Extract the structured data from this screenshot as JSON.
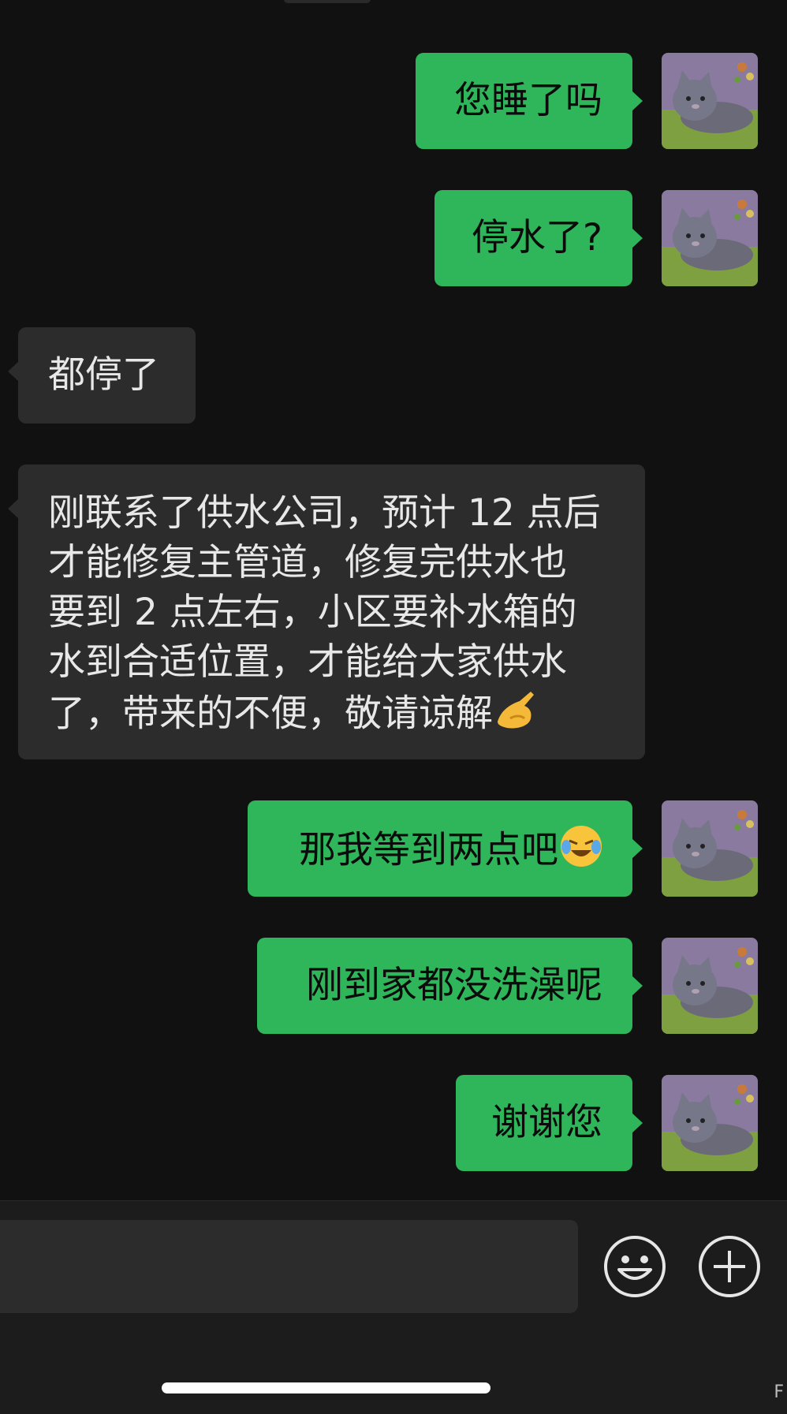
{
  "conversation": {
    "messages": [
      {
        "id": "m1",
        "side": "outgoing",
        "text": "您睡了吗"
      },
      {
        "id": "m2",
        "side": "outgoing",
        "text": "停水了?"
      },
      {
        "id": "m3",
        "side": "incoming",
        "text": "都停了"
      },
      {
        "id": "m4",
        "side": "incoming",
        "lines": [
          "刚联系了供水公司，预计 12 点后",
          "才能修复主管道，修复完供水也",
          "要到 2 点左右，小区要补水箱的",
          "水到合适位置，才能给大家供水",
          "了，带来的不便，敬请谅解"
        ],
        "emoji": "👌"
      },
      {
        "id": "m5",
        "side": "outgoing",
        "text": "那我等到两点吧",
        "emoji": "😭"
      },
      {
        "id": "m6",
        "side": "outgoing",
        "text": "刚到家都没洗澡呢"
      },
      {
        "id": "m7",
        "side": "outgoing",
        "text": "谢谢您"
      }
    ]
  },
  "input_bar": {
    "message_value": "",
    "emoji_button_icon": "smiley-icon",
    "more_button_icon": "plus-circle-icon"
  },
  "colors": {
    "background": "#111111",
    "outgoing_bubble": "#2fb65b",
    "incoming_bubble": "#2c2c2c",
    "input_bar": "#1c1c1c"
  }
}
